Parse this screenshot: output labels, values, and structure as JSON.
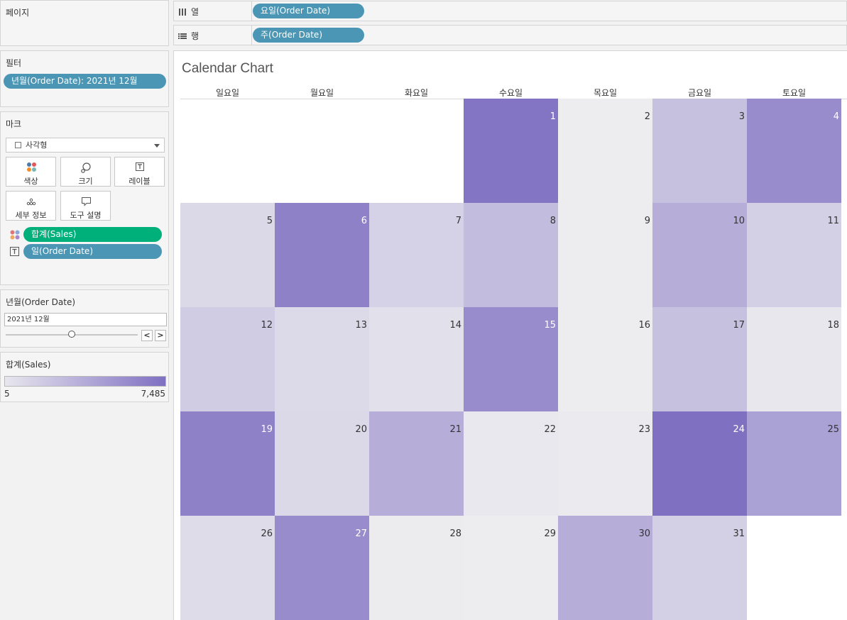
{
  "pages": {
    "title": "페이지"
  },
  "shelves": {
    "columns": {
      "label": "열",
      "pill": "요일(Order Date)"
    },
    "rows": {
      "label": "행",
      "pill": "주(Order Date)"
    }
  },
  "filters": {
    "title": "필터",
    "pill": "년월(Order Date): 2021년 12월"
  },
  "marks": {
    "title": "마크",
    "mark_type": "사각형",
    "buttons": {
      "color": "색상",
      "size": "크기",
      "label": "레이블",
      "detail": "세부 정보",
      "tooltip": "도구 설명"
    },
    "fields": {
      "sales": "합계(Sales)",
      "day": "일(Order Date)"
    }
  },
  "date_control": {
    "title": "년월(Order Date)",
    "value": "2021년 12월",
    "prev": "<",
    "next": ">"
  },
  "legend": {
    "title": "합계(Sales)",
    "min": "5",
    "max": "7,485"
  },
  "view": {
    "title": "Calendar Chart",
    "weekdays": [
      "일요일",
      "월요일",
      "화요일",
      "수요일",
      "목요일",
      "금요일",
      "토요일"
    ]
  },
  "chart_data": {
    "type": "heatmap",
    "title": "Calendar Chart",
    "x_categories": [
      "일요일",
      "월요일",
      "화요일",
      "수요일",
      "목요일",
      "금요일",
      "토요일"
    ],
    "color_range": [
      5,
      7485
    ],
    "color_low": "#eeeef0",
    "color_high": "#7f70c2",
    "weeks": [
      [
        null,
        null,
        null,
        {
          "day": "1",
          "value": 7200
        },
        {
          "day": "2",
          "value": 100
        },
        {
          "day": "3",
          "value": 2700
        },
        {
          "day": "4",
          "value": 5800
        }
      ],
      [
        {
          "day": "5",
          "value": 1300
        },
        {
          "day": "6",
          "value": 6500
        },
        {
          "day": "7",
          "value": 1700
        },
        {
          "day": "8",
          "value": 3000
        },
        {
          "day": "9",
          "value": 50
        },
        {
          "day": "10",
          "value": 3800
        },
        {
          "day": "11",
          "value": 1800
        }
      ],
      [
        {
          "day": "12",
          "value": 2000
        },
        {
          "day": "13",
          "value": 1200
        },
        {
          "day": "14",
          "value": 800
        },
        {
          "day": "15",
          "value": 5800
        },
        {
          "day": "16",
          "value": 80
        },
        {
          "day": "17",
          "value": 2700
        },
        {
          "day": "18",
          "value": 400
        }
      ],
      [
        {
          "day": "19",
          "value": 6500
        },
        {
          "day": "20",
          "value": 1300
        },
        {
          "day": "21",
          "value": 3800
        },
        {
          "day": "22",
          "value": 350
        },
        {
          "day": "23",
          "value": 200
        },
        {
          "day": "24",
          "value": 7485
        },
        {
          "day": "25",
          "value": 4600
        }
      ],
      [
        {
          "day": "26",
          "value": 1100
        },
        {
          "day": "27",
          "value": 5800
        },
        {
          "day": "28",
          "value": 150
        },
        {
          "day": "29",
          "value": 40
        },
        {
          "day": "30",
          "value": 3800
        },
        {
          "day": "31",
          "value": 1800
        },
        null
      ]
    ]
  }
}
